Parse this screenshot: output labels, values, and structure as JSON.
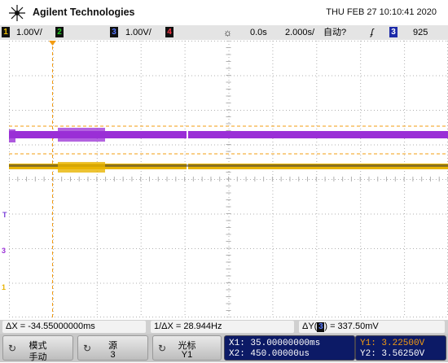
{
  "header": {
    "brand": "Agilent Technologies",
    "datetime": "THU FEB 27 10:10:41 2020"
  },
  "status": {
    "ch1_label": "1",
    "ch1_scale": "1.00V/",
    "ch2_label": "2",
    "ch3_label": "3",
    "ch3_scale": "1.00V/",
    "ch4_label": "4",
    "run_icon": "☼",
    "delay": "0.0s",
    "timebase": "2.000s/",
    "trigger_mode": "自动?",
    "trigger_edge": "ʄ",
    "trigger_source": "3",
    "trigger_level": "925"
  },
  "markers": {
    "trigger_level": "T",
    "ch3_ground": "3",
    "ch1_ground": "1"
  },
  "measurements": {
    "delta_x": "ΔX = -34.55000000ms",
    "inv_delta_x": "1/ΔX = 28.944Hz",
    "delta_y_prefix": "ΔY(",
    "delta_y_ch": "3",
    "delta_y_suffix": ") = 337.50mV"
  },
  "softkeys": {
    "mode_line1": "模式",
    "mode_line2": "手动",
    "source_line1": "源",
    "source_line2": "3",
    "cursor_line1": "光标",
    "cursor_line2": "Y1"
  },
  "cursors": {
    "x1": "X1: 35.00000000ms",
    "x2": "X2: 450.00000us",
    "y1": "Y1: 3.22500V",
    "y2": "Y2: 3.56250V"
  },
  "colors": {
    "ch1": "#e8b400",
    "ch3": "#9a2fd6",
    "grid": "#b0b0b0",
    "cursor": "#f39c12",
    "panel": "#0c1a66"
  }
}
